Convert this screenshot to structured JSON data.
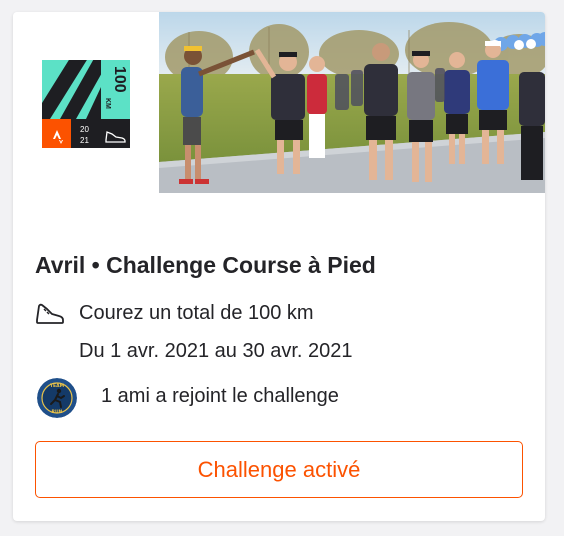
{
  "challenge": {
    "title": "Avril • Challenge Course à Pied",
    "goal": "Courez un total de 100 km",
    "dates": "Du 1 avr. 2021 au 30 avr. 2021",
    "friends_joined": "1 ami a rejoint le challenge",
    "button_label": "Challenge activé"
  },
  "badge": {
    "distance": "100",
    "unit": "KM",
    "year_top": "20",
    "year_bottom": "21",
    "icon": "running-shoe-icon",
    "logo": "strava-logo"
  },
  "avatar_text": {
    "top": "TEAM",
    "bottom": "RUN"
  },
  "colors": {
    "accent": "#fc5200",
    "badge_teal": "#5ce1c6",
    "badge_dark": "#1e1e22",
    "text": "#242428"
  }
}
